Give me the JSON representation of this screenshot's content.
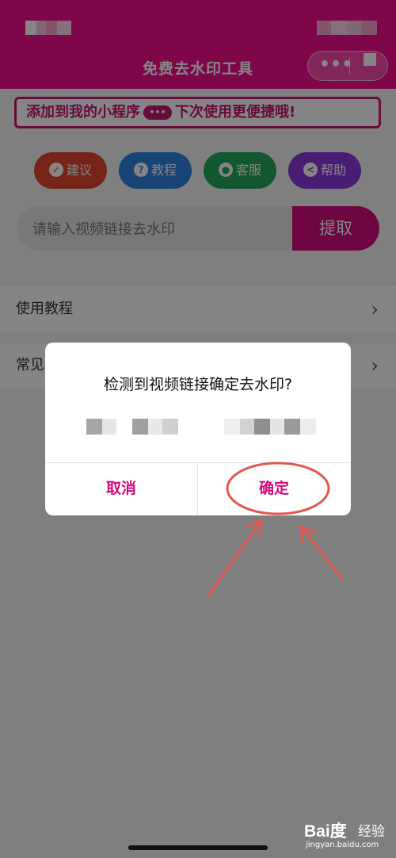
{
  "colors": {
    "primary": "#f40f8c",
    "accent": "#d40b7c",
    "btn_suggest": "#e0452d",
    "btn_tutorial": "#2f83e0",
    "btn_service": "#23a85a",
    "btn_help": "#8b3be0"
  },
  "navbar": {
    "title": "免费去水印工具",
    "more_icon": "more-dots-icon",
    "home_icon": "home-target-icon"
  },
  "banner": {
    "text_before": "添加到我的小程序",
    "pill": "•••",
    "text_after": "下次使用更便捷哦!"
  },
  "feature_buttons": [
    {
      "label": "建议",
      "icon": "check-circle-icon",
      "glyph": "✓"
    },
    {
      "label": "教程",
      "icon": "question-circle-icon",
      "glyph": "?"
    },
    {
      "label": "客服",
      "icon": "user-circle-icon",
      "glyph": "●"
    },
    {
      "label": "帮助",
      "icon": "share-icon",
      "glyph": "<"
    }
  ],
  "search": {
    "placeholder": "请输入视频链接去水印",
    "submit_label": "提取"
  },
  "menu": [
    {
      "label": "使用教程"
    },
    {
      "label": "常见"
    }
  ],
  "dialog": {
    "title": "检测到视频链接确定去水印?",
    "cancel_label": "取消",
    "confirm_label": "确定"
  },
  "watermark": {
    "logo": "Bai度",
    "text": "经验",
    "sub": "jingyan.baidu.com"
  }
}
